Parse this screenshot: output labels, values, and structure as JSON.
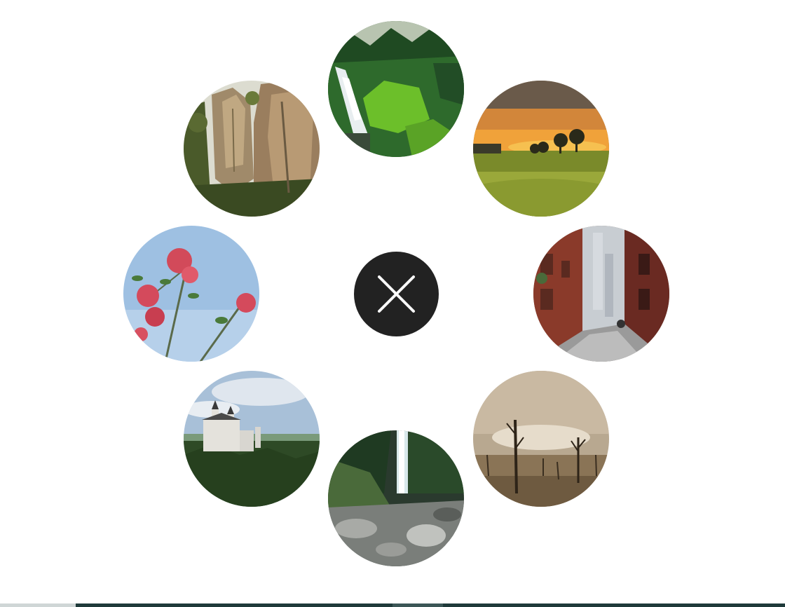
{
  "menu": {
    "close_label": "",
    "items": [
      {
        "id": "waterfall-forest",
        "icon": "waterfall-forest-photo"
      },
      {
        "id": "sunset-field",
        "icon": "sunset-field-photo"
      },
      {
        "id": "city-alley",
        "icon": "city-alley-photo"
      },
      {
        "id": "dead-trees",
        "icon": "dead-trees-photo"
      },
      {
        "id": "waterfall-rocks",
        "icon": "waterfall-rocks-photo"
      },
      {
        "id": "castle",
        "icon": "castle-photo"
      },
      {
        "id": "pink-flowers",
        "icon": "pink-flowers-photo"
      },
      {
        "id": "rock-cliffs",
        "icon": "rock-cliffs-photo"
      }
    ]
  },
  "colors": {
    "background": "#ffffff",
    "close_button": "#222222",
    "close_icon": "#ffffff",
    "bottom_bar": "#1f3a3a"
  }
}
